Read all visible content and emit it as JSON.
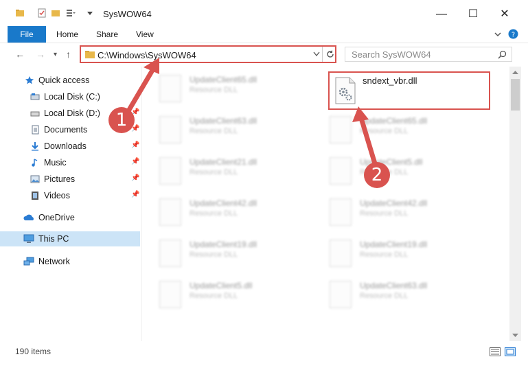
{
  "window": {
    "title": "SysWOW64",
    "minimize_glyph": "—",
    "maximize_glyph": "☐",
    "close_glyph": "✕"
  },
  "ribbon": {
    "tabs": [
      "File",
      "Home",
      "Share",
      "View"
    ]
  },
  "nav": {
    "address": "C:\\Windows\\SysWOW64",
    "search_placeholder": "Search SysWOW64"
  },
  "sidebar": {
    "items": [
      {
        "label": "Quick access",
        "icon": "star-icon",
        "pinned": false
      },
      {
        "label": "Local Disk (C:)",
        "icon": "drive-icon",
        "pinned": false
      },
      {
        "label": "Local Disk (D:)",
        "icon": "drive-icon",
        "pinned": true
      },
      {
        "label": "Documents",
        "icon": "documents-icon",
        "pinned": true
      },
      {
        "label": "Downloads",
        "icon": "download-icon",
        "pinned": true
      },
      {
        "label": "Music",
        "icon": "music-icon",
        "pinned": true
      },
      {
        "label": "Pictures",
        "icon": "pictures-icon",
        "pinned": true
      },
      {
        "label": "Videos",
        "icon": "videos-icon",
        "pinned": true
      },
      {
        "label": "OneDrive",
        "icon": "cloud-icon",
        "pinned": false
      },
      {
        "label": "This PC",
        "icon": "computer-icon",
        "pinned": false,
        "selected": true
      },
      {
        "label": "Network",
        "icon": "network-icon",
        "pinned": false
      }
    ]
  },
  "files": {
    "left_column": [
      {
        "name": "UpdateClient65.dll",
        "type": "Resource DLL"
      },
      {
        "name": "UpdateClient63.dll",
        "type": "Resource DLL"
      },
      {
        "name": "UpdateClient21.dll",
        "type": "Resource DLL"
      },
      {
        "name": "UpdateClient42.dll",
        "type": "Resource DLL"
      },
      {
        "name": "UpdateClient19.dll",
        "type": "Resource DLL"
      },
      {
        "name": "UpdateClient5.dll",
        "type": "Resource DLL"
      }
    ],
    "right_column": [
      {
        "name": "UpdateClient65.dll",
        "type": "Resource DLL"
      },
      {
        "name": "UpdateClient5.dll",
        "type": "Resource DLL"
      },
      {
        "name": "UpdateClient42.dll",
        "type": "Resource DLL"
      },
      {
        "name": "UpdateClient19.dll",
        "type": "Resource DLL"
      },
      {
        "name": "UpdateClient63.dll",
        "type": "Resource DLL"
      }
    ],
    "highlighted": {
      "name": "sndext_vbr.dll"
    }
  },
  "status": {
    "item_count": "190 items"
  },
  "annotations": {
    "step1": "1",
    "step2": "2",
    "color": "#d9534f"
  }
}
